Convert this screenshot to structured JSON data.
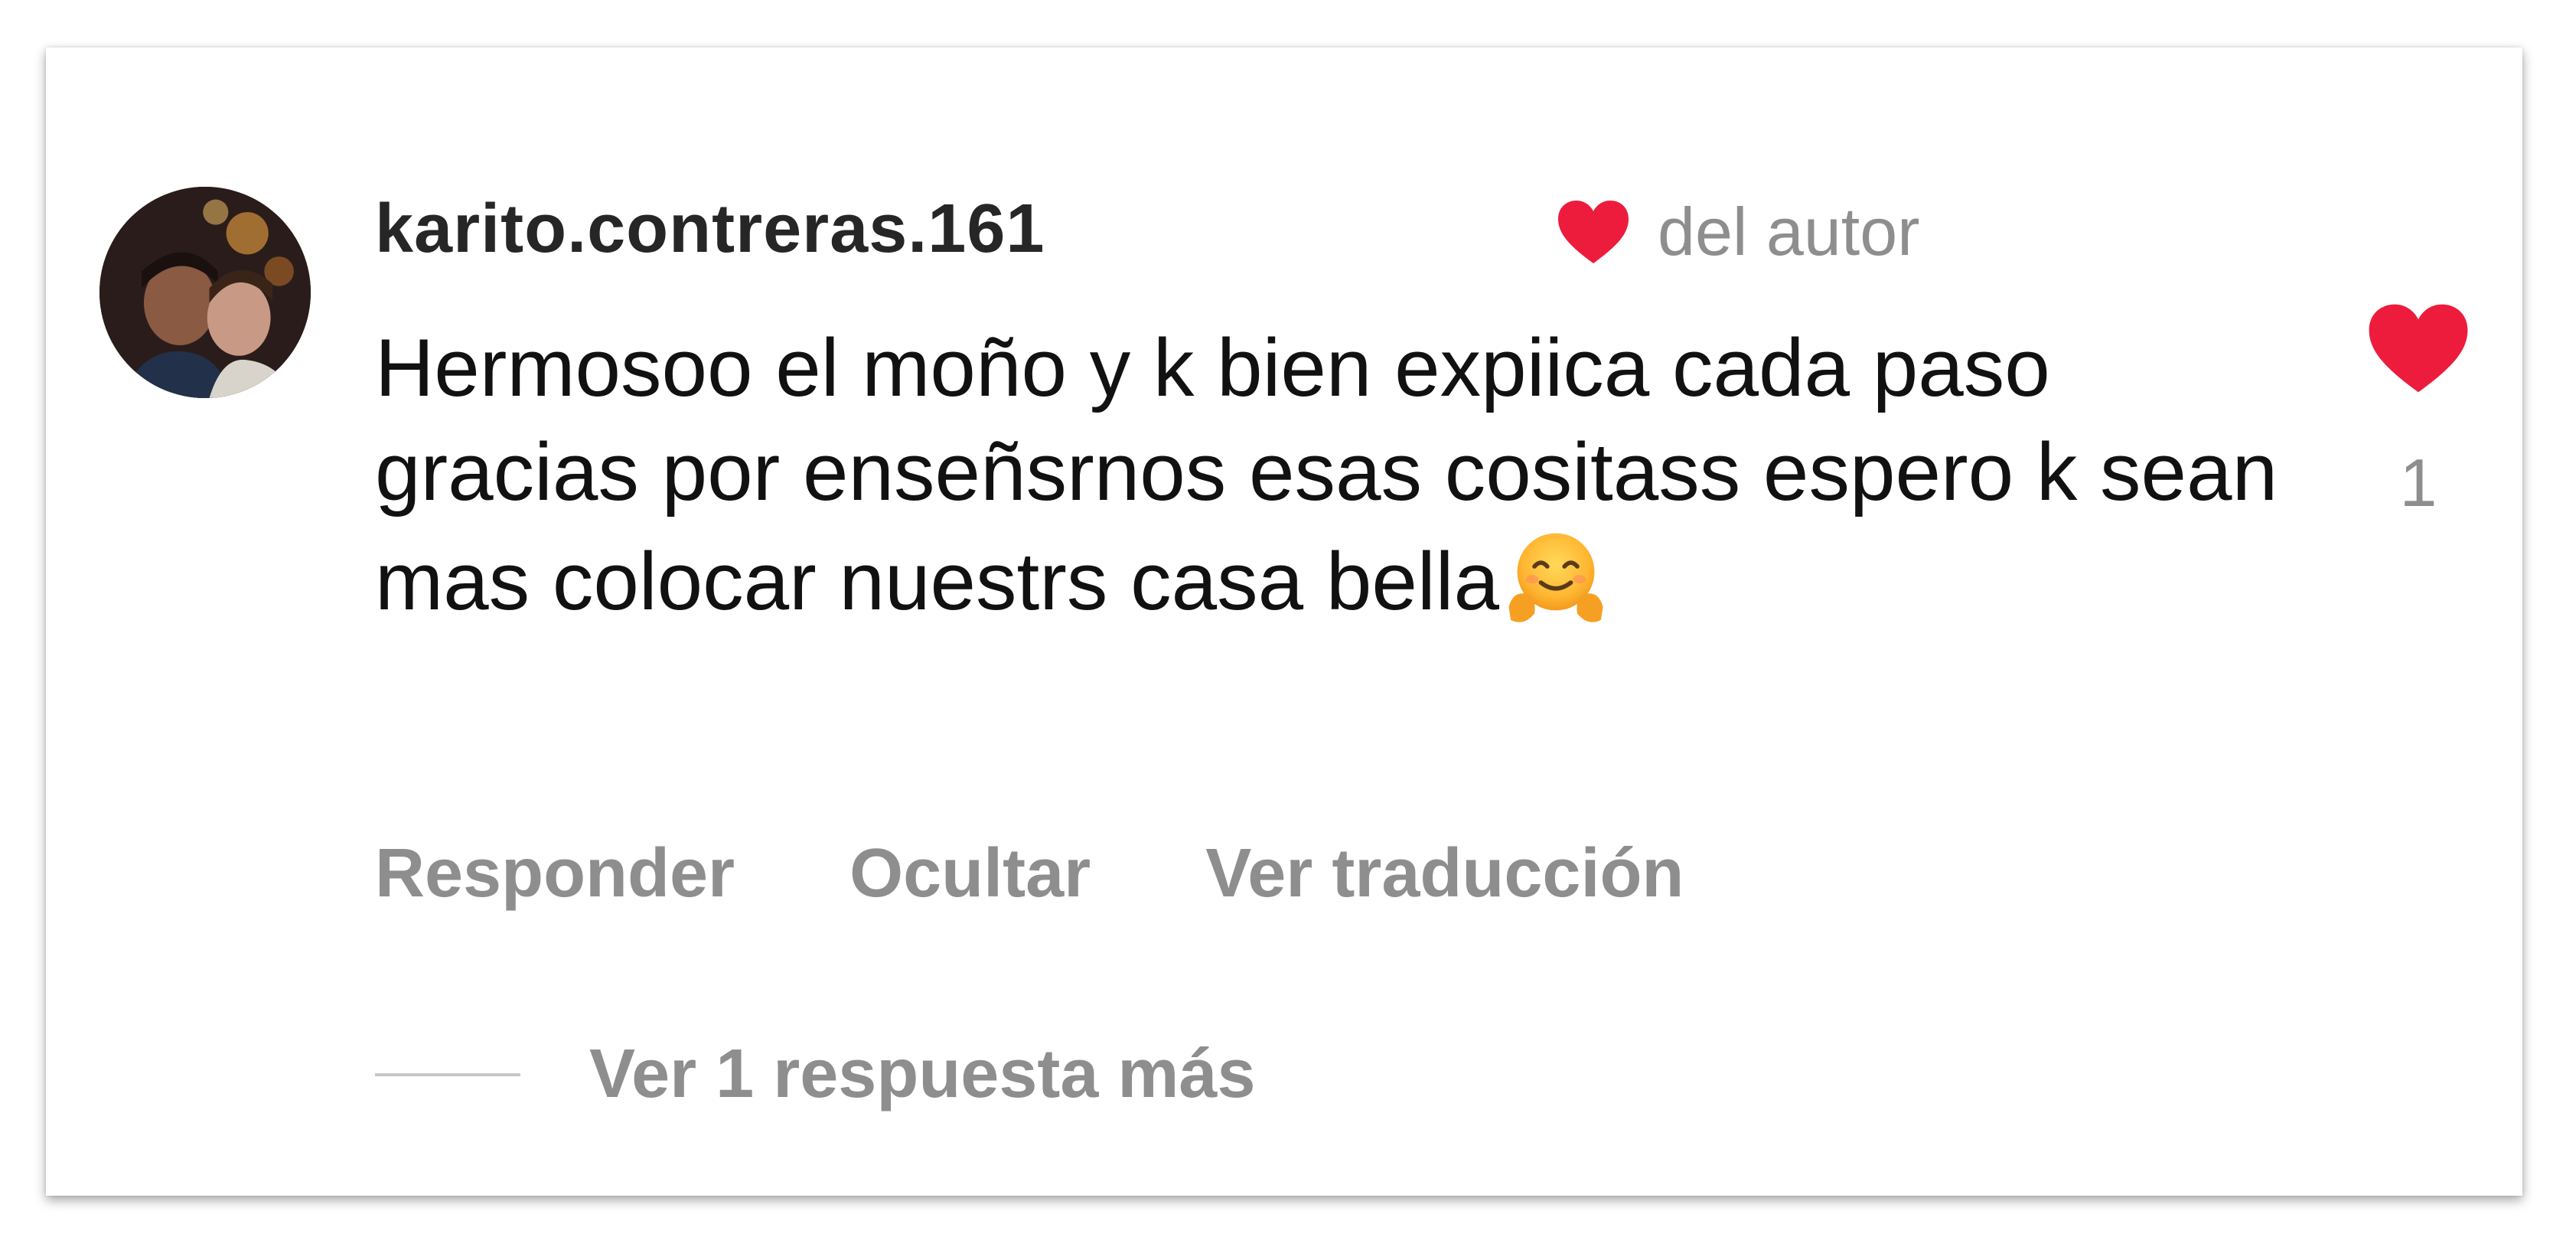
{
  "comment": {
    "username": "karito.contreras.161",
    "author_like_label": "del autor",
    "text": "Hermosoo el moño y k bien expiica cada paso gracias por enseñsrnos esas cositass espero k sean mas colocar nuestrs casa bella",
    "emoji": "smiling-face-with-open-hands-emoji",
    "like_count": "1",
    "like_icon": "heart-icon",
    "like_color": "#ed1c3c"
  },
  "actions": {
    "reply_label": "Responder",
    "hide_label": "Ocultar",
    "translate_label": "Ver traducción"
  },
  "replies": {
    "view_more_label": "Ver 1 respuesta más"
  }
}
